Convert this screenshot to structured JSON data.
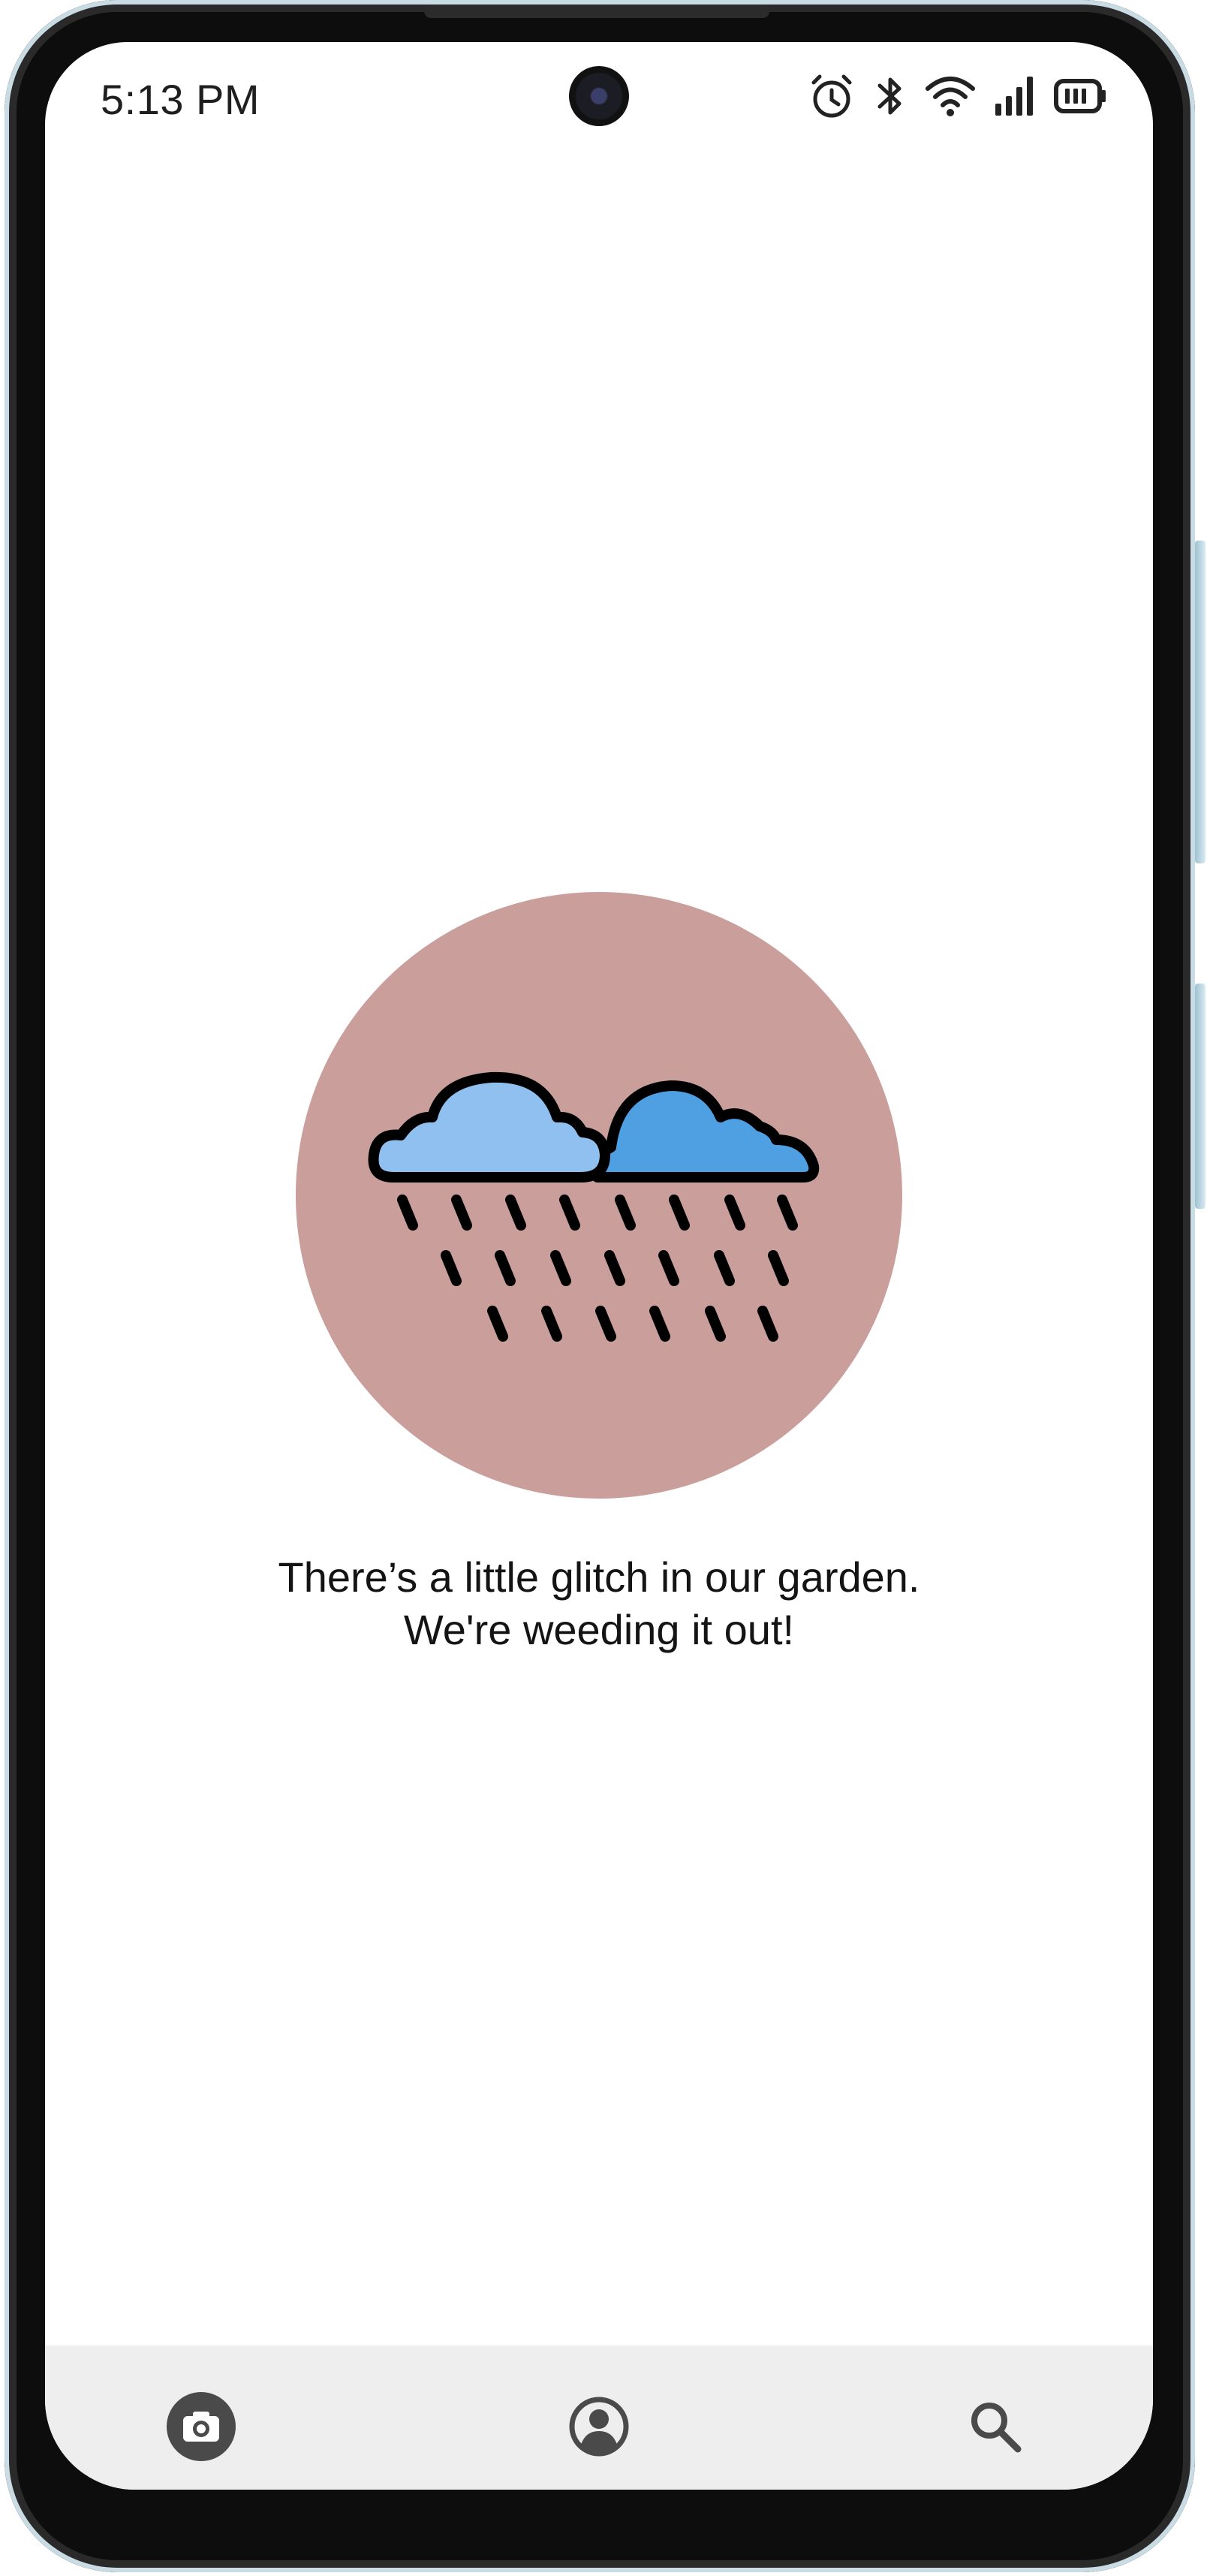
{
  "status_bar": {
    "time": "5:13 PM",
    "icons": [
      "alarm-icon",
      "bluetooth-icon",
      "wifi-icon",
      "signal-icon",
      "battery-icon"
    ]
  },
  "error_screen": {
    "illustration": "rain-clouds-icon",
    "illustration_bg": "#c99e9b",
    "message_line1": "There’s a little glitch in our garden.",
    "message_line2": "We're weeding it out!"
  },
  "bottom_nav": {
    "items": [
      {
        "icon": "camera-icon"
      },
      {
        "icon": "profile-icon"
      },
      {
        "icon": "search-icon"
      }
    ],
    "background": "#eeeeee"
  }
}
